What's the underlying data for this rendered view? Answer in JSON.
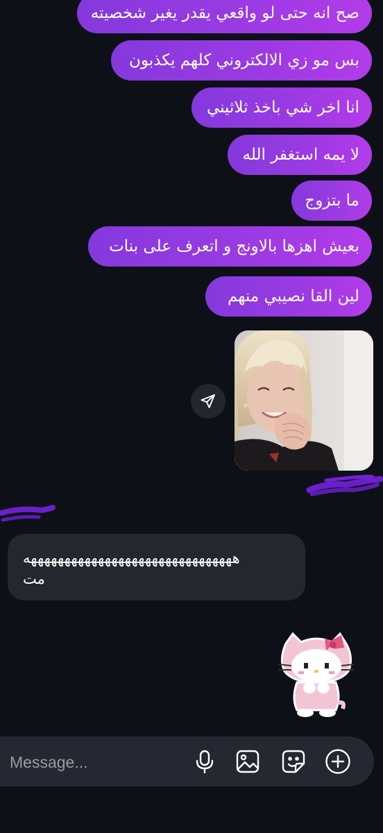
{
  "messages_out": [
    {
      "text": "صح انه حتى لو واقعي يقدر يغير شخصيته"
    },
    {
      "text": "بس مو زي الالكتروني كلهم يكذبون"
    },
    {
      "text": "انا اخر شي باخذ ثلاثيني"
    },
    {
      "text": "لا يمه استغفر الله"
    },
    {
      "text": "ما بتزوج"
    },
    {
      "text": "بعيش اهزها بالاونج و اتعرف على بنات"
    },
    {
      "text": "لين القا نصيبي منهم"
    }
  ],
  "photo_message": {
    "icon": "share-icon"
  },
  "message_in": {
    "line1": "هههههههههههههههههههههههههههههههه",
    "line2": "مت"
  },
  "sticker": {
    "icon": "hello-kitty-sticker"
  },
  "composer": {
    "placeholder": "Message...",
    "icons": [
      "mic-icon",
      "gallery-icon",
      "sticker-icon",
      "add-icon"
    ]
  },
  "colors": {
    "background": "#0d1017",
    "outgoing_bubble_start": "#8439dc",
    "outgoing_bubble_end": "#b23ce9",
    "incoming_bubble": "#24272e",
    "composer_bg": "#252830",
    "scribble": "#6a1fc8"
  }
}
